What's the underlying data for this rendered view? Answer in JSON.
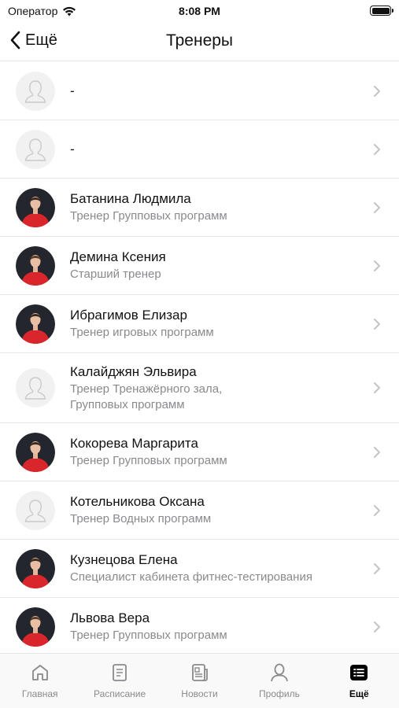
{
  "status_bar": {
    "carrier": "Оператор",
    "time": "8:08 PM"
  },
  "nav": {
    "back_label": "Ещё",
    "title": "Тренеры"
  },
  "trainers": [
    {
      "name": "-",
      "role": "",
      "avatar": "placeholder"
    },
    {
      "name": "-",
      "role": "",
      "avatar": "placeholder"
    },
    {
      "name": "Батанина Людмила",
      "role": "Тренер Групповых программ",
      "avatar": "photo"
    },
    {
      "name": "Демина Ксения",
      "role": "Старший тренер",
      "avatar": "photo"
    },
    {
      "name": "Ибрагимов Елизар",
      "role": "Тренер игровых программ",
      "avatar": "photo"
    },
    {
      "name": "Калайджян Эльвира",
      "role": "Тренер Тренажёрного зала,",
      "role2": "Групповых программ",
      "avatar": "placeholder"
    },
    {
      "name": "Кокорева Маргарита",
      "role": "Тренер Групповых программ",
      "avatar": "photo"
    },
    {
      "name": "Котельникова Оксана",
      "role": "Тренер Водных программ",
      "avatar": "placeholder"
    },
    {
      "name": "Кузнецова Елена",
      "role": "Специалист кабинета фитнес-тестирования",
      "avatar": "photo"
    },
    {
      "name": "Львова Вера",
      "role": "Тренер Групповых программ",
      "avatar": "photo"
    }
  ],
  "tabs": [
    {
      "label": "Главная",
      "icon": "home-icon",
      "active": false
    },
    {
      "label": "Расписание",
      "icon": "schedule-icon",
      "active": false
    },
    {
      "label": "Новости",
      "icon": "news-icon",
      "active": false
    },
    {
      "label": "Профиль",
      "icon": "profile-icon",
      "active": false
    },
    {
      "label": "Ещё",
      "icon": "more-icon",
      "active": true
    }
  ],
  "colors": {
    "accent": "#000000",
    "secondary_text": "#8a8a8e",
    "shirt": "#d9262c"
  }
}
